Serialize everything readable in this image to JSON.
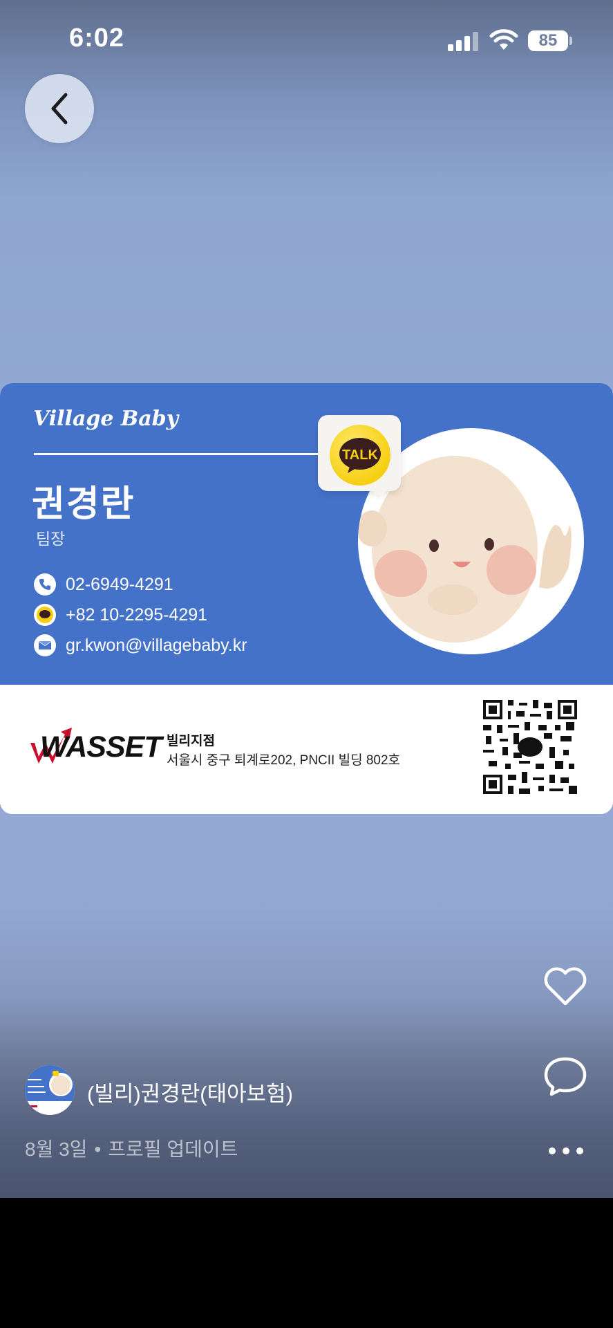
{
  "status_bar": {
    "time": "6:02",
    "battery": "85"
  },
  "card": {
    "brand": "Village Baby",
    "name": "권경란",
    "title": "팀장",
    "contacts": {
      "phone": "02-6949-4291",
      "mobile": "+82 10-2295-4291",
      "email": "gr.kwon@villagebaby.kr"
    },
    "talk_label": "TALK",
    "company_logo": "WASSET",
    "branch_name": "빌리지점",
    "branch_address": "서울시 중구 퇴계로202,  PNCII 빌딩 802호"
  },
  "post": {
    "author": "(빌리)권경란(태아보험)",
    "date": "8월 3일",
    "separator": "•",
    "action": "프로필 업데이트"
  },
  "icons": {
    "back": "chevron-left-icon",
    "like": "heart-icon",
    "comment": "speech-bubble-icon",
    "more": "more-dots-icon"
  },
  "colors": {
    "card_blue": "#4572c9",
    "kakao_yellow": "#f6cf12",
    "wasset_red": "#c8102e"
  }
}
